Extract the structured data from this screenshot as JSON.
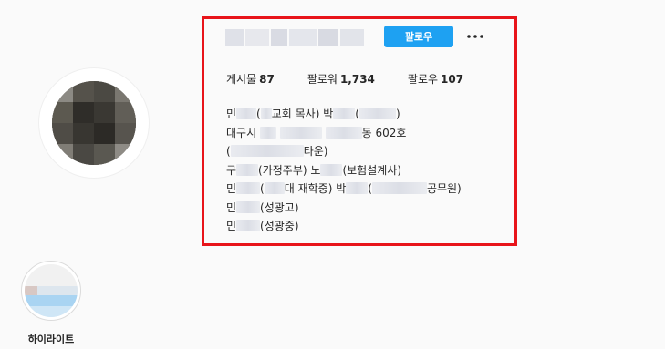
{
  "profile": {
    "follow_label": "팔로우",
    "more_icon": "more-horizontal-icon"
  },
  "stats": {
    "posts_label": "게시물",
    "posts_value": "87",
    "followers_label": "팔로워",
    "followers_value": "1,734",
    "following_label": "팔로우",
    "following_value": "107"
  },
  "bio": {
    "line1": {
      "a": "민",
      "b": "(",
      "c": "교회 목사) 박",
      "d": "(",
      "e": ")"
    },
    "line2": {
      "a": "대구시",
      "b": "동 602호"
    },
    "line3": {
      "a": "(",
      "b": "타운)"
    },
    "line4": {
      "a": "구",
      "b": "(가정주부) 노",
      "c": "(보험설계사)"
    },
    "line5": {
      "a": "민",
      "b": "(",
      "c": "대 재학중) 박",
      "d": "(",
      "e": "공무원)"
    },
    "line6": {
      "a": "민",
      "b": "(성광고)"
    },
    "line7": {
      "a": "민",
      "b": "(성광중)"
    }
  },
  "highlight": {
    "label": "하이라이트"
  },
  "colors": {
    "accent": "#1ea1f2",
    "annotation_red": "#e8141a"
  }
}
